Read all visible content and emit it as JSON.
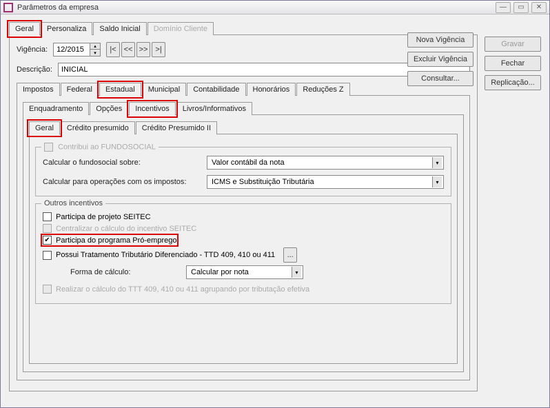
{
  "window": {
    "title": "Parâmetros da empresa"
  },
  "main_tabs": {
    "t0": "Geral",
    "t1": "Personaliza",
    "t2": "Saldo Inicial",
    "t3": "Domínio Cliente"
  },
  "vigencia": {
    "label": "Vigência:",
    "value": "12/2015",
    "nav_first": "|<",
    "nav_prev": "<<",
    "nav_next": ">>",
    "nav_last": ">|"
  },
  "descricao": {
    "label": "Descrição:",
    "value": "INICIAL"
  },
  "impostos_tabs": {
    "t0": "Impostos",
    "t1": "Federal",
    "t2": "Estadual",
    "t3": "Municipal",
    "t4": "Contabilidade",
    "t5": "Honorários",
    "t6": "Reduções Z"
  },
  "estadual_tabs": {
    "t0": "Enquadramento",
    "t1": "Opções",
    "t2": "Incentivos",
    "t3": "Livros/Informativos"
  },
  "incentivos_tabs": {
    "t0": "Geral",
    "t1": "Crédito presumido",
    "t2": "Crédito Presumido II"
  },
  "fundosocial": {
    "title": "Contribui ao FUNDOSOCIAL",
    "row1_label": "Calcular o fundosocial sobre:",
    "row1_value": "Valor contábil da nota",
    "row2_label": "Calcular para operações com os impostos:",
    "row2_value": "ICMS e Substituição Tributária"
  },
  "outros": {
    "title": "Outros incentivos",
    "c1": "Participa de projeto SEITEC",
    "c2": "Centralizar o cálculo do incentivo SEITEC",
    "c3": "Participa do programa Pró-emprego",
    "c4": "Possui Tratamento Tributário Diferenciado - TTD 409, 410 ou 411",
    "forma_label": "Forma de cálculo:",
    "forma_value": "Calcular por nota",
    "c5": "Realizar o cálculo do TTT 409, 410 ou 411 agrupando por tributação efetiva",
    "browse": "..."
  },
  "right_actions": {
    "a1": "Nova Vigência",
    "a2": "Excluir Vigência",
    "a3": "Consultar..."
  },
  "side_buttons": {
    "b1": "Gravar",
    "b2": "Fechar",
    "b3": "Replicação..."
  }
}
